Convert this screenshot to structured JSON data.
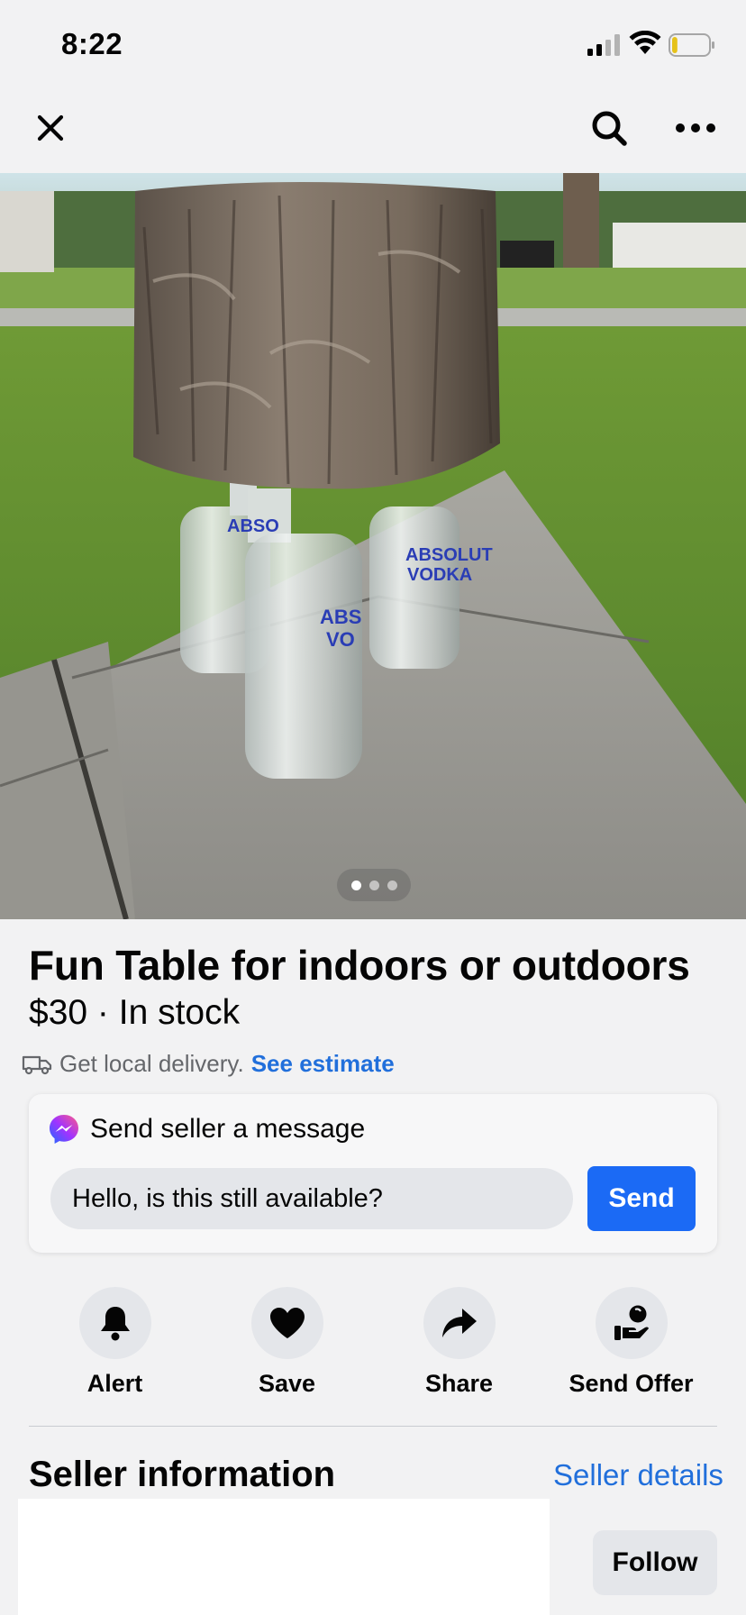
{
  "status_bar": {
    "time": "8:22",
    "signal_icon": "cellular-signal-icon",
    "wifi_icon": "wifi-icon",
    "battery_icon": "battery-low-icon",
    "battery_level": 0.15
  },
  "nav": {
    "close_icon": "close-icon",
    "search_icon": "search-icon",
    "more_icon": "more-horizontal-icon"
  },
  "photo": {
    "subject": "listing-photo",
    "page_count": 3,
    "active_page": 1
  },
  "listing": {
    "title": "Fun Table for indoors or outdoors",
    "price_line": "$30 · In stock",
    "delivery_text": "Get local delivery.",
    "delivery_link": "See estimate"
  },
  "message": {
    "heading": "Send seller a message",
    "input_value": "Hello, is this still available?",
    "send_label": "Send"
  },
  "actions": [
    {
      "label": "Alert",
      "icon": "bell-icon"
    },
    {
      "label": "Save",
      "icon": "heart-icon"
    },
    {
      "label": "Share",
      "icon": "share-arrow-icon"
    },
    {
      "label": "Send Offer",
      "icon": "offer-hand-icon"
    }
  ],
  "seller": {
    "heading": "Seller information",
    "details_link": "Seller details",
    "follow_label": "Follow"
  },
  "colors": {
    "background": "#f2f2f3",
    "accent": "#1b6af5",
    "link": "#216fdb",
    "button_gray": "#e4e6ea"
  }
}
